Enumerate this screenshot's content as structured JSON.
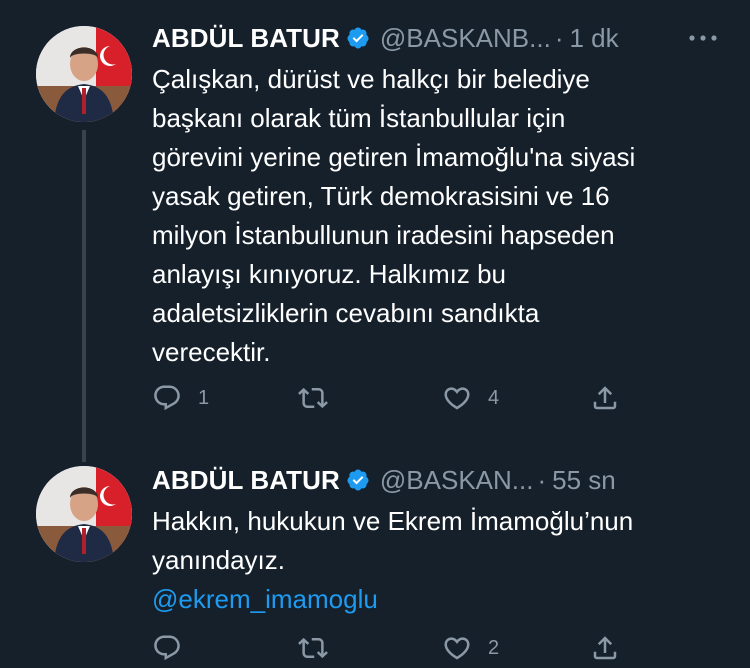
{
  "tweets": [
    {
      "author_name": "ABDÜL BATUR",
      "handle": "@BASKANB...",
      "separator": "·",
      "time": "1 dk",
      "text_lines": [
        "Çalışkan, dürüst ve halkçı bir belediye",
        "başkanı olarak tüm İstanbullular için",
        "görevini yerine getiren İmamoğlu'na siyasi",
        "yasak getiren, Türk demokrasisini ve 16",
        "milyon İstanbullunun iradesini hapseden",
        "anlayışı kınıyoruz. Halkımız bu",
        "adaletsizliklerin cevabını sandıkta",
        "verecektir."
      ],
      "reply_count": "1",
      "retweet_count": "",
      "like_count": "4"
    },
    {
      "author_name": "ABDÜL BATUR",
      "handle": "@BASKAN...",
      "separator": "·",
      "time": "55 sn",
      "text_lines": [
        "Hakkın, hukukun ve Ekrem İmamoğlu’nun",
        "yanındayız."
      ],
      "mention": "@ekrem_imamoglu",
      "reply_count": "",
      "retweet_count": "",
      "like_count": "2"
    }
  ],
  "icons": {
    "verified": "verified-badge-icon",
    "more": "more-horizontal-icon",
    "reply": "reply-bubble-icon",
    "retweet": "retweet-arrows-icon",
    "like": "heart-icon",
    "share": "share-upload-icon"
  },
  "colors": {
    "background": "#15202b",
    "text": "#ffffff",
    "secondary": "#8b98a5",
    "accent": "#1d9bf0",
    "thread_line": "#38444d"
  }
}
